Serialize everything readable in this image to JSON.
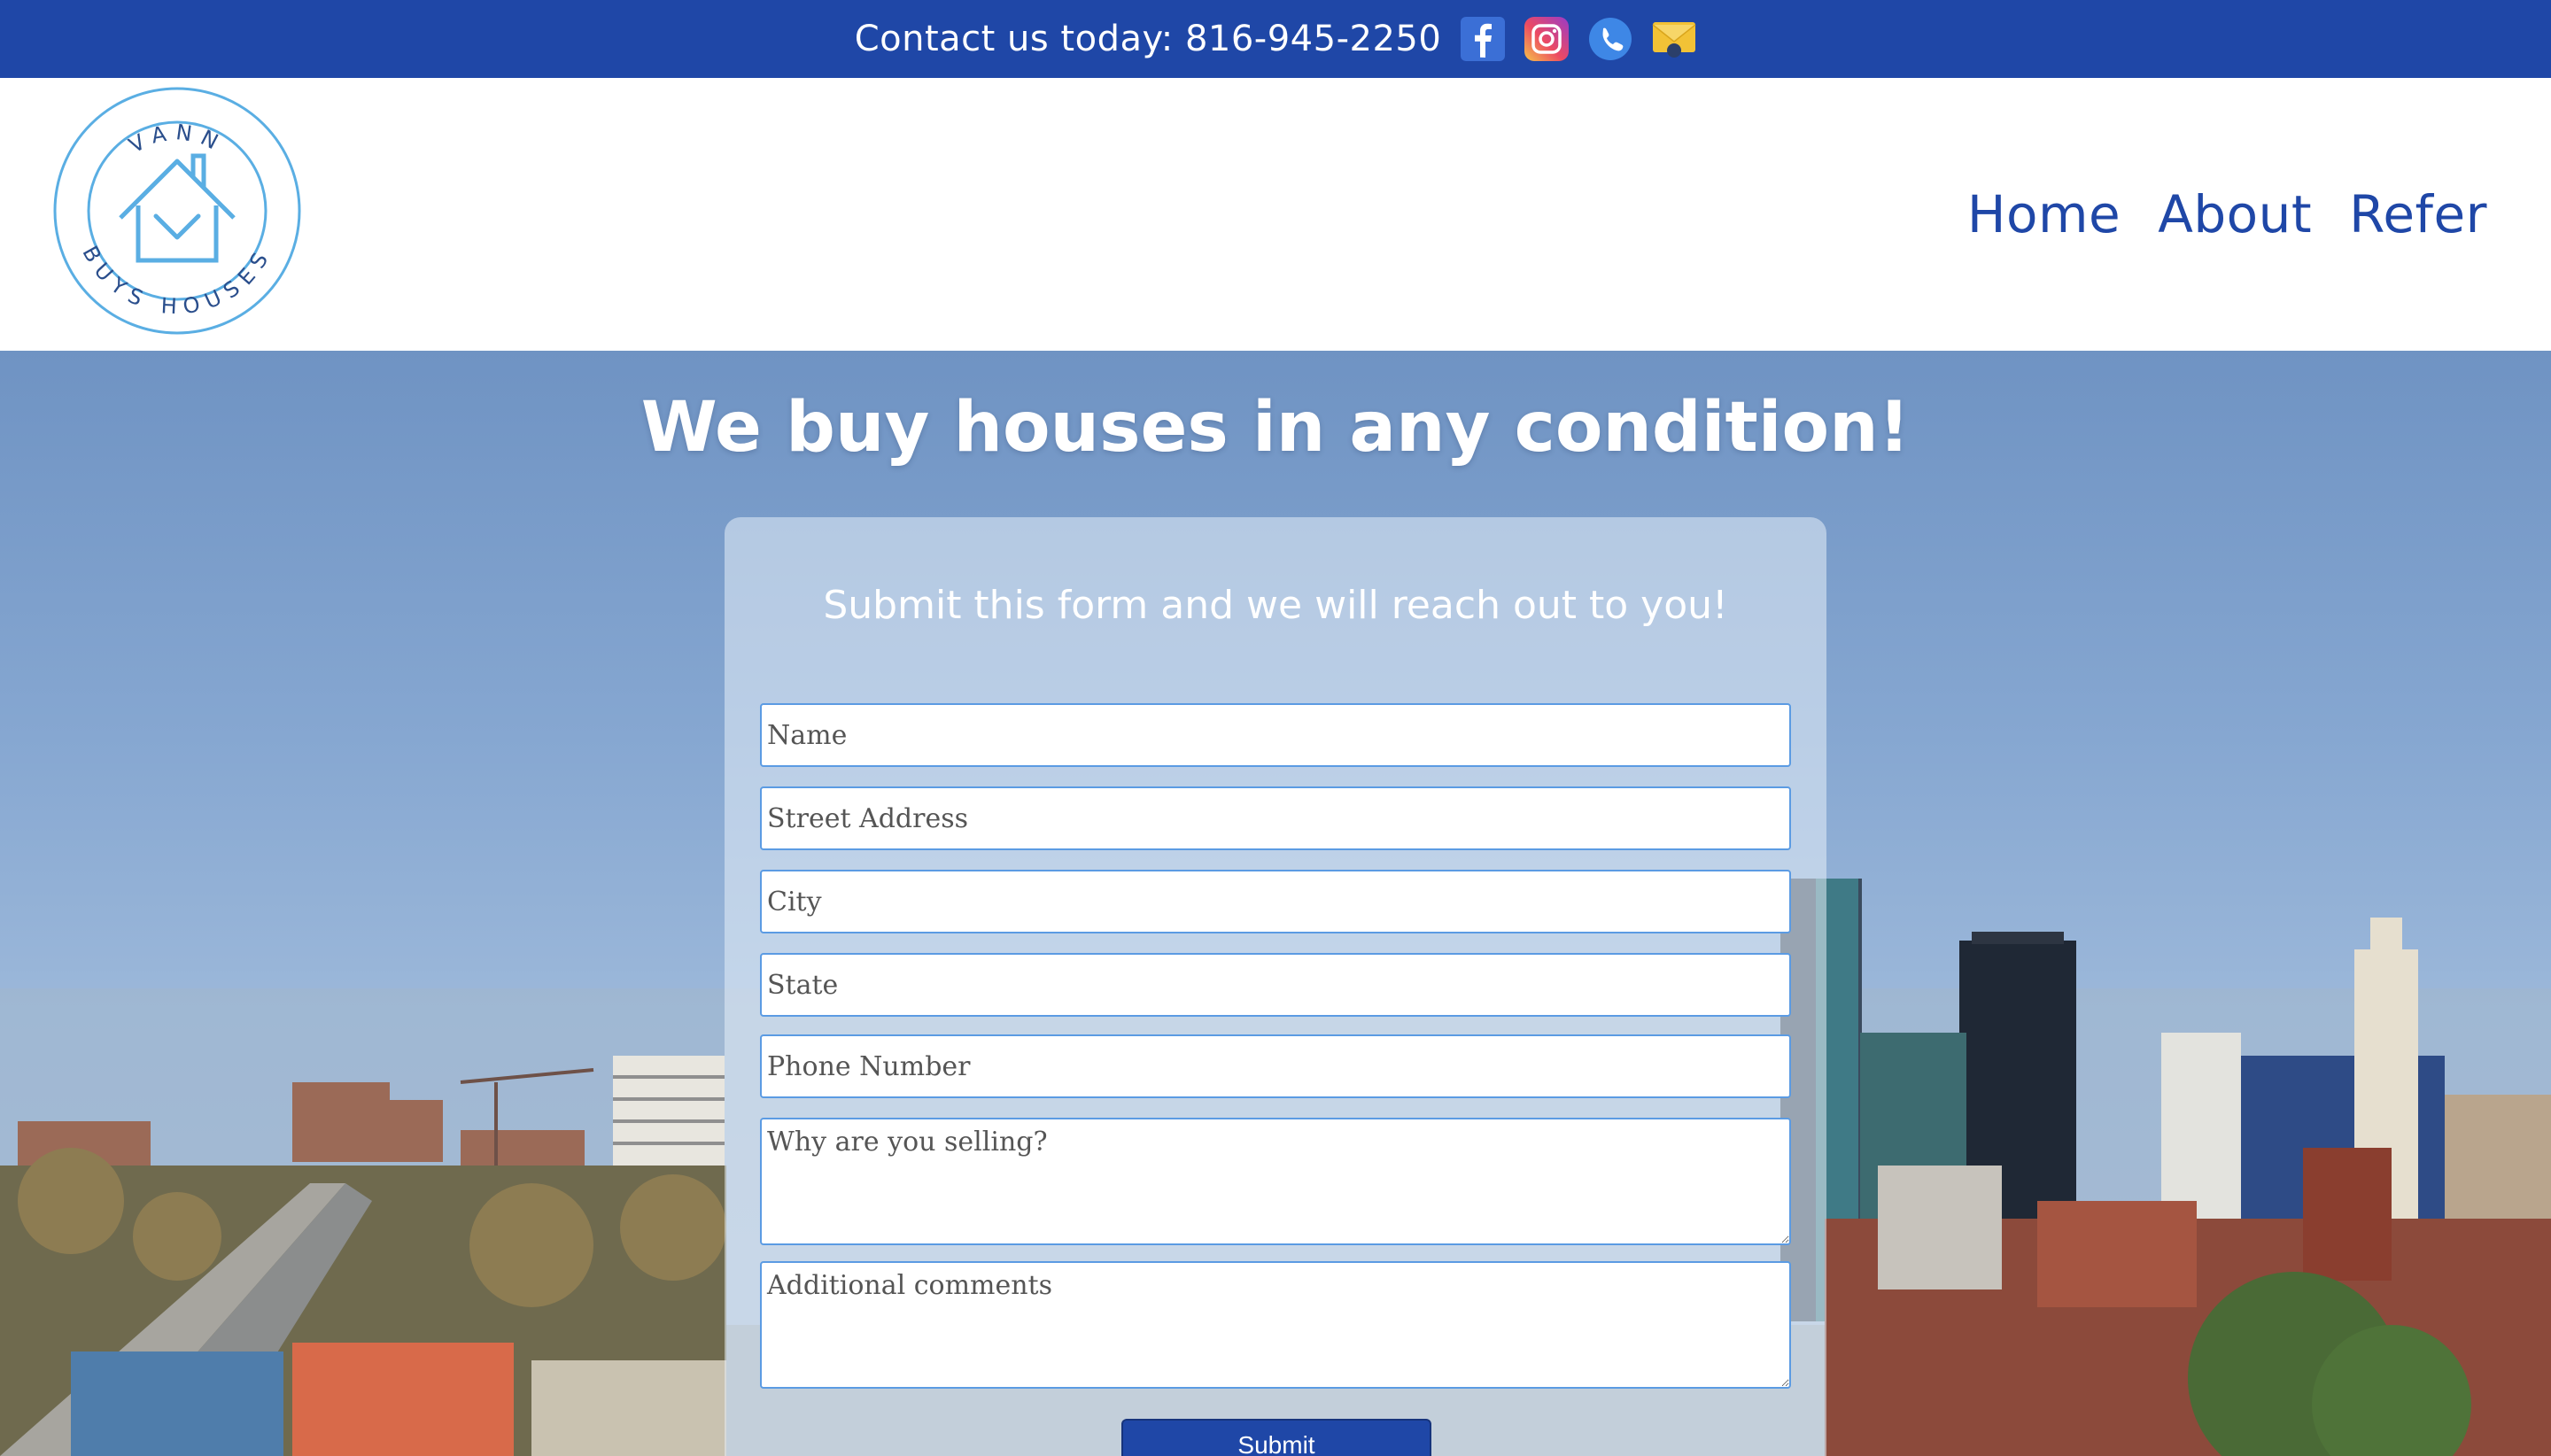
{
  "topbar": {
    "contact_text": "Contact us today: 816-945-2250",
    "icons": [
      "facebook-icon",
      "instagram-icon",
      "phone-icon",
      "email-icon"
    ],
    "background": "#1f47a7"
  },
  "logo": {
    "top_text": "VANN",
    "bottom_text": "BUYS HOUSES",
    "color": "#5aaee3"
  },
  "nav": {
    "items": [
      "Home",
      "About",
      "Refer"
    ],
    "color": "#1f47a7"
  },
  "hero": {
    "title": "We buy houses in any condition!"
  },
  "form": {
    "subtitle": "Submit this form and we will reach out to you!",
    "name_placeholder": "Name",
    "street_placeholder": "Street Address",
    "city_placeholder": "City",
    "state_placeholder": "State",
    "phone_placeholder": "Phone Number",
    "reason_placeholder": "Why are you selling?",
    "comments_placeholder": "Additional comments",
    "submit_label": "Submit"
  }
}
